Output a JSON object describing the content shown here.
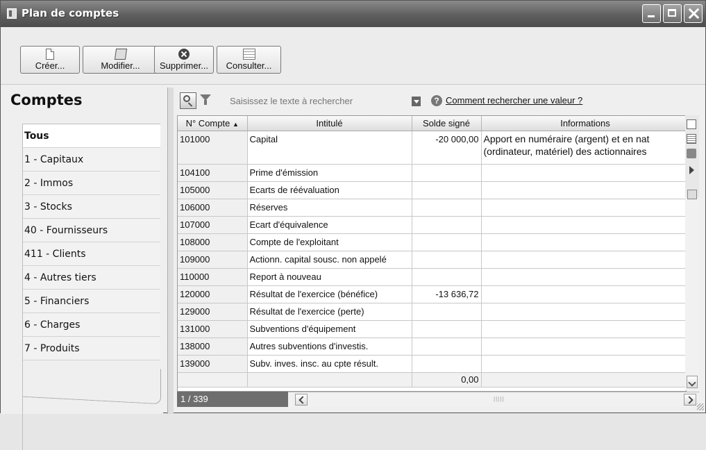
{
  "window": {
    "title": "Plan de comptes"
  },
  "toolbar": {
    "buttons": [
      {
        "label": "Créer...",
        "icon": "new-document-icon"
      },
      {
        "label": "Modifier...",
        "icon": "edit-icon"
      },
      {
        "label": "Supprimer...",
        "icon": "delete-icon"
      },
      {
        "label": "Consulter...",
        "icon": "view-icon"
      }
    ]
  },
  "left_panel": {
    "title": "Comptes",
    "categories": [
      "Tous",
      "1 - Capitaux",
      "2 - Immos",
      "3 - Stocks",
      "40 - Fournisseurs",
      "411 - Clients",
      "4 - Autres tiers",
      "5 - Financiers",
      "6 - Charges",
      "7 - Produits"
    ],
    "active": "Tous"
  },
  "search": {
    "placeholder": "Saisissez le texte à rechercher",
    "help_link": "Comment rechercher une valeur ?"
  },
  "table": {
    "columns": [
      "N° Compte",
      "Intitulé",
      "Solde signé",
      "Informations"
    ],
    "sort_indicator": "▲",
    "rows": [
      {
        "code": "101000",
        "label": "Capital",
        "balance": "-20 000,00",
        "info": "Apport en numéraire (argent) et en nat (ordinateur, matériel) des actionnaires"
      },
      {
        "code": "104100",
        "label": "Prime d'émission",
        "balance": "",
        "info": ""
      },
      {
        "code": "105000",
        "label": "Ecarts de réévaluation",
        "balance": "",
        "info": ""
      },
      {
        "code": "106000",
        "label": "Réserves",
        "balance": "",
        "info": ""
      },
      {
        "code": "107000",
        "label": "Ecart d'équivalence",
        "balance": "",
        "info": ""
      },
      {
        "code": "108000",
        "label": "Compte de l'exploitant",
        "balance": "",
        "info": ""
      },
      {
        "code": "109000",
        "label": "Actionn. capital sousc. non appelé",
        "balance": "",
        "info": ""
      },
      {
        "code": "110000",
        "label": "Report à nouveau",
        "balance": "",
        "info": ""
      },
      {
        "code": "120000",
        "label": "Résultat de l'exercice (bénéfice)",
        "balance": "-13 636,72",
        "info": ""
      },
      {
        "code": "129000",
        "label": "Résultat de l'exercice (perte)",
        "balance": "",
        "info": ""
      },
      {
        "code": "131000",
        "label": "Subventions d'équipement",
        "balance": "",
        "info": ""
      },
      {
        "code": "138000",
        "label": "Autres subventions d'investis.",
        "balance": "",
        "info": ""
      },
      {
        "code": "139000",
        "label": "Subv. inves. insc. au cpte résult.",
        "balance": "",
        "info": ""
      }
    ],
    "total": "0,00"
  },
  "status": {
    "pager": "1 / 339"
  }
}
